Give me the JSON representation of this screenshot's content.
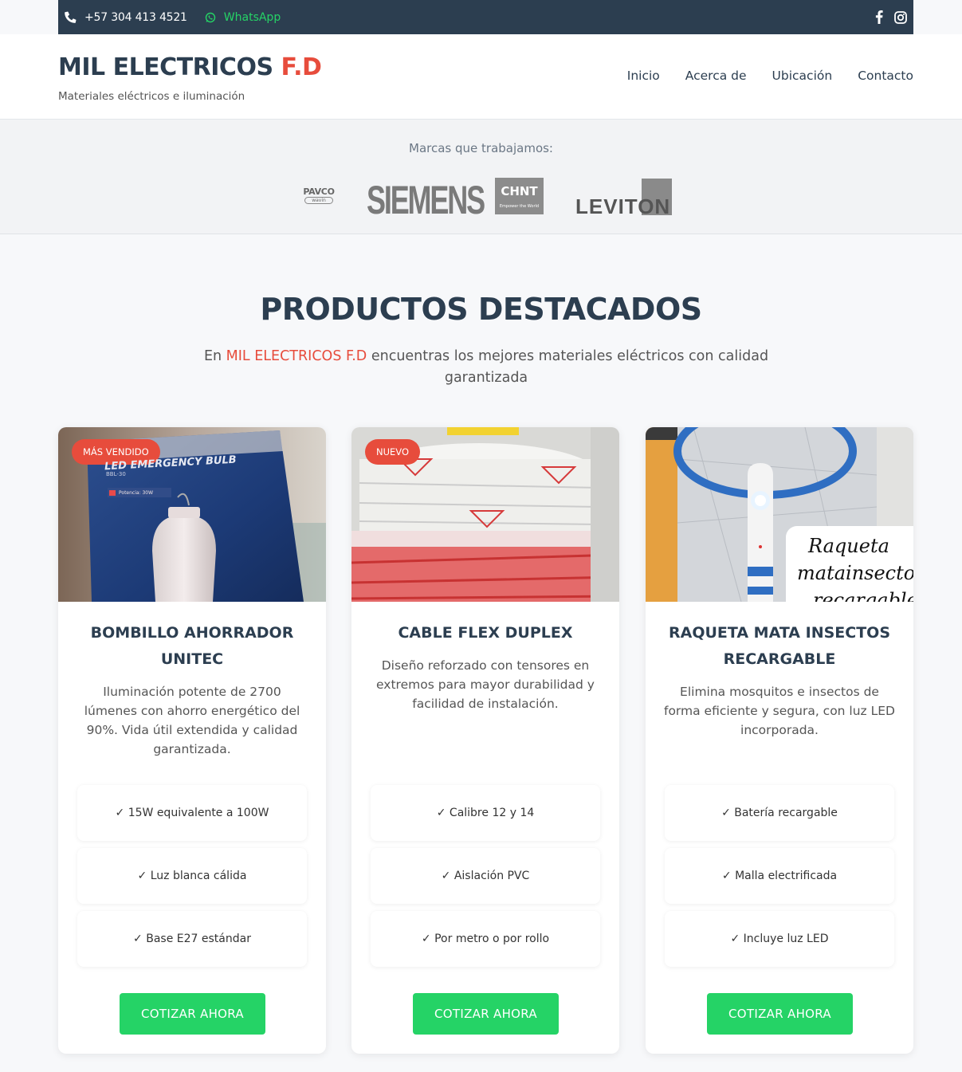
{
  "topbar": {
    "phone": "+57 304 413 4521",
    "whatsapp": "WhatsApp"
  },
  "header": {
    "brand_main": "MIL ELECTRICOS",
    "brand_accent": "F.D",
    "tagline": "Materiales eléctricos e iluminación",
    "nav": [
      "Inicio",
      "Acerca de",
      "Ubicación",
      "Contacto"
    ]
  },
  "brands": {
    "title": "Marcas que trabajamos:",
    "logos": [
      {
        "name": "PAVCO",
        "sub": "wavin"
      },
      {
        "name": "SIEMENS"
      },
      {
        "name": "CHNT",
        "sub": "Empower the World"
      },
      {
        "name": "LEVITON"
      }
    ]
  },
  "section": {
    "title": "PRODUCTOS DESTACADOS",
    "subtitle_pre": "En ",
    "subtitle_brand": "MIL ELECTRICOS F.D",
    "subtitle_post": " encuentras los mejores materiales eléctricos con calidad garantizada"
  },
  "products": [
    {
      "badge": "MÁS VENDIDO",
      "image_text": [
        "LED EMERGENCY BULB",
        "BBL-30",
        "Potencia: 30W"
      ],
      "title": "BOMBILLO AHORRADOR UNITEC",
      "description": "Iluminación potente de 2700 lúmenes con ahorro energético del 90%. Vida útil extendida y calidad garantizada.",
      "features": [
        "✓ 15W equivalente a 100W",
        "✓ Luz blanca cálida",
        "✓ Base E27 estándar"
      ],
      "button": "COTIZAR AHORA"
    },
    {
      "badge": "NUEVO",
      "title": "CABLE FLEX DUPLEX",
      "description": "Diseño reforzado con tensores en extremos para mayor durabilidad y facilidad de instalación.",
      "features": [
        "✓ Calibre 12 y 14",
        "✓ Aislación PVC",
        "✓ Por metro o por rollo"
      ],
      "button": "COTIZAR AHORA"
    },
    {
      "image_text": [
        "Raqueta",
        "matainsectos",
        "recargable"
      ],
      "title": "RAQUETA MATA INSECTOS RECARGABLE",
      "description": "Elimina mosquitos e insectos de forma eficiente y segura, con luz LED incorporada.",
      "features": [
        "✓ Batería recargable",
        "✓ Malla electrificada",
        "✓ Incluye luz LED"
      ],
      "button": "COTIZAR AHORA"
    }
  ],
  "colors": {
    "primary": "#2c3e50",
    "accent": "#e74c3c",
    "whatsapp": "#25d366"
  }
}
